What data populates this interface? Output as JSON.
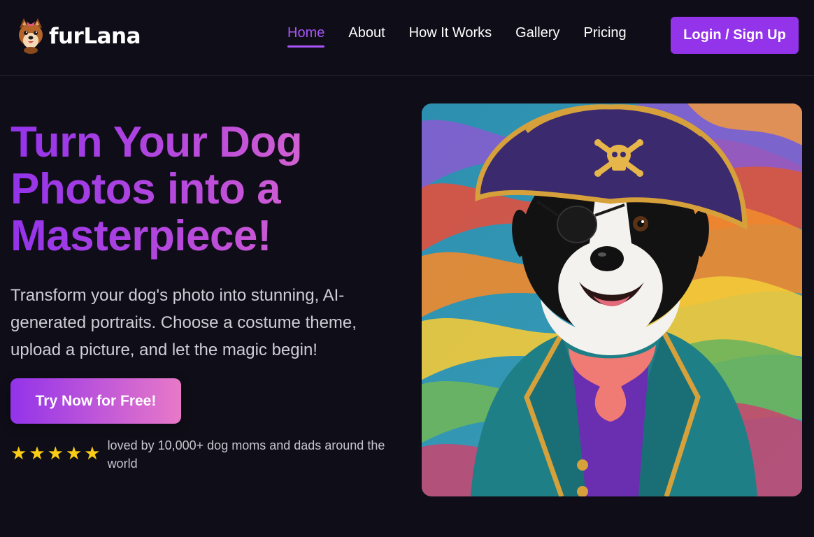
{
  "brand": {
    "name": "furLana",
    "logo_icon": "dog-face-icon"
  },
  "nav": {
    "items": [
      {
        "label": "Home",
        "active": true
      },
      {
        "label": "About",
        "active": false
      },
      {
        "label": "How It Works",
        "active": false
      },
      {
        "label": "Gallery",
        "active": false
      },
      {
        "label": "Pricing",
        "active": false
      }
    ],
    "login_label": "Login / Sign Up"
  },
  "hero": {
    "title_line1": "Turn Your Dog",
    "title_line2": "Photos into a",
    "title_line3": "Masterpiece!",
    "subtitle": "Transform your dog's photo into stunning, AI-generated portraits. Choose a costume theme, upload a picture, and let the magic begin!",
    "cta_label": "Try Now for Free!",
    "rating_stars": 5,
    "rating_text": "loved by 10,000+ dog moms and dads around the world"
  },
  "colors": {
    "background": "#0f0d17",
    "accent": "#9333ea",
    "gradient_end": "#e879c8",
    "star": "#facc15"
  }
}
